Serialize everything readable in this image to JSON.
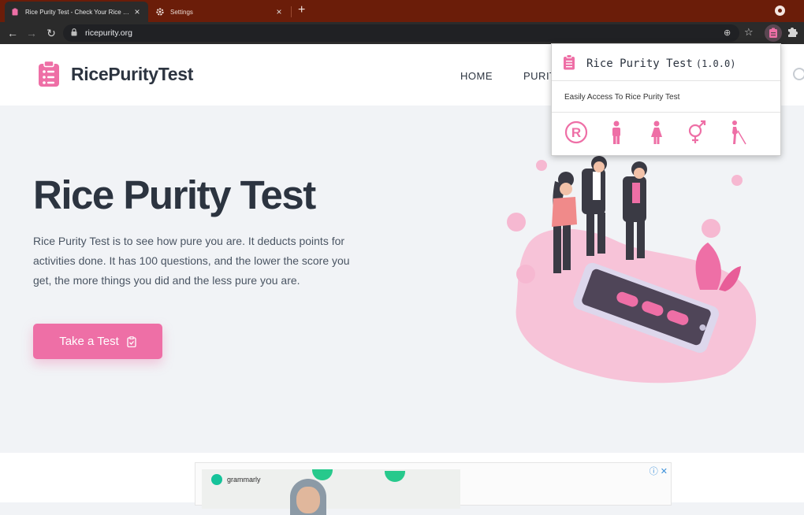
{
  "browser": {
    "tabs": [
      {
        "title": "Rice Purity Test - Check Your Rice Purity Test",
        "active": true
      },
      {
        "title": "Settings",
        "active": false
      }
    ],
    "url": "ricepurity.org"
  },
  "site": {
    "brand": "RicePurityTest",
    "nav": {
      "home": "HOME",
      "purity": "PURIT"
    },
    "hero": {
      "title": "Rice Purity Test",
      "description": "Rice Purity Test is to see how pure you are. It deducts points for activities done. It has 100 questions, and the lower the score you get, the more things you did and the less pure you are.",
      "cta": "Take a Test"
    },
    "ad": {
      "brand": "grammarly"
    }
  },
  "extension_popup": {
    "title": "Rice Purity Test",
    "version": "(1.0.0)",
    "description": "Easily Access To Rice Purity Test",
    "icons": [
      "registered-icon",
      "male-icon",
      "female-icon",
      "gender-icon",
      "blind-person-icon"
    ]
  },
  "colors": {
    "accent": "#ee6fa6",
    "tabbar": "#6b1d09",
    "toolbar": "#2b2b2b",
    "text_dark": "#2c3440"
  }
}
